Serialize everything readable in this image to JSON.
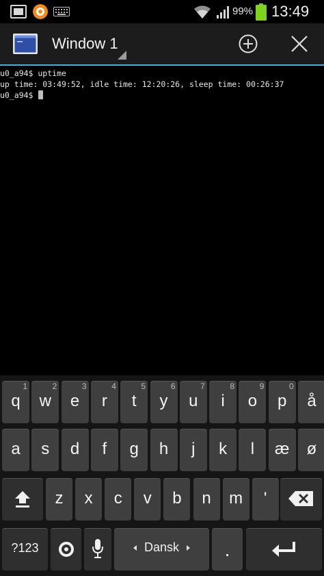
{
  "status_bar": {
    "battery_percent": "99%",
    "clock": "13:49",
    "icons": [
      "gallery-icon",
      "app-notification-icon",
      "keyboard-icon",
      "wifi-icon",
      "signal-icon",
      "battery-icon"
    ],
    "battery_color": "#7ed321"
  },
  "action_bar": {
    "window_title": "Window 1",
    "accent_color": "#33b5e5",
    "icons": [
      "terminal-window-icon",
      "add-window-icon",
      "close-window-icon"
    ]
  },
  "terminal": {
    "lines": [
      "u0_a94$ uptime",
      "up time: 03:49:52, idle time: 12:20:26, sleep time: 00:26:37",
      "u0_a94$ "
    ]
  },
  "keyboard": {
    "row1": [
      {
        "label": "q",
        "hint": "1"
      },
      {
        "label": "w",
        "hint": "2"
      },
      {
        "label": "e",
        "hint": "3"
      },
      {
        "label": "r",
        "hint": "4"
      },
      {
        "label": "t",
        "hint": "5"
      },
      {
        "label": "y",
        "hint": "6"
      },
      {
        "label": "u",
        "hint": "7"
      },
      {
        "label": "i",
        "hint": "8"
      },
      {
        "label": "o",
        "hint": "9"
      },
      {
        "label": "p",
        "hint": "0"
      },
      {
        "label": "å",
        "hint": ""
      }
    ],
    "row2": [
      "a",
      "s",
      "d",
      "f",
      "g",
      "h",
      "j",
      "k",
      "l",
      "æ",
      "ø"
    ],
    "row3": [
      "z",
      "x",
      "c",
      "v",
      "b",
      "n",
      "m",
      "'"
    ],
    "symbols_label": "?123",
    "space_label": "Dansk",
    "period_label": ".",
    "icons": [
      "shift-icon",
      "backspace-icon",
      "settings-icon",
      "microphone-icon",
      "enter-icon"
    ]
  }
}
